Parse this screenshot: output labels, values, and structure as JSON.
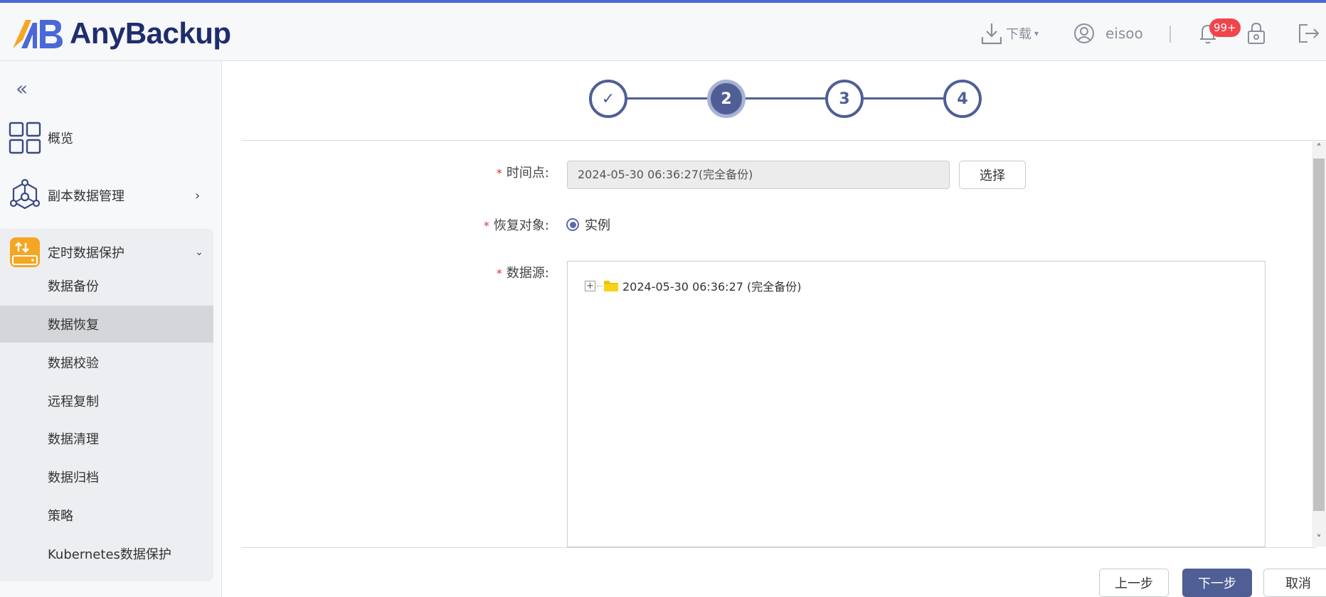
{
  "app": {
    "name": "AnyBackup"
  },
  "header": {
    "download_label": "下载",
    "user_name": "eisoo",
    "notification_badge": "99+"
  },
  "sidebar": {
    "items": [
      {
        "label": "概览",
        "icon": "dashboard-icon"
      },
      {
        "label": "副本数据管理",
        "icon": "network-icon"
      },
      {
        "label": "定时数据保护",
        "icon": "storage-icon"
      }
    ],
    "sub_items": [
      "数据备份",
      "数据恢复",
      "数据校验",
      "远程复制",
      "数据清理",
      "数据归档",
      "策略",
      "Kubernetes数据保护"
    ],
    "active_sub_item": "数据恢复"
  },
  "stepper": {
    "steps": [
      "✓",
      "2",
      "3",
      "4"
    ],
    "current": 2
  },
  "form": {
    "time_point_label": "时间点:",
    "time_point_value": "2024-05-30 06:36:27(完全备份)",
    "select_button": "选择",
    "restore_target_label": "恢复对象:",
    "restore_target_option": "实例",
    "data_source_label": "数据源:",
    "tree_root_label": "2024-05-30 06:36:27 (完全备份)",
    "required_mark": "*"
  },
  "footer": {
    "prev_label": "上一步",
    "next_label": "下一步",
    "cancel_label": "取消"
  },
  "colors": {
    "accent": "#4f5f95",
    "brand_navy": "#1f2d6e",
    "brand_orange": "#f5a623",
    "required": "#e0303a",
    "badge": "#f0454b"
  }
}
